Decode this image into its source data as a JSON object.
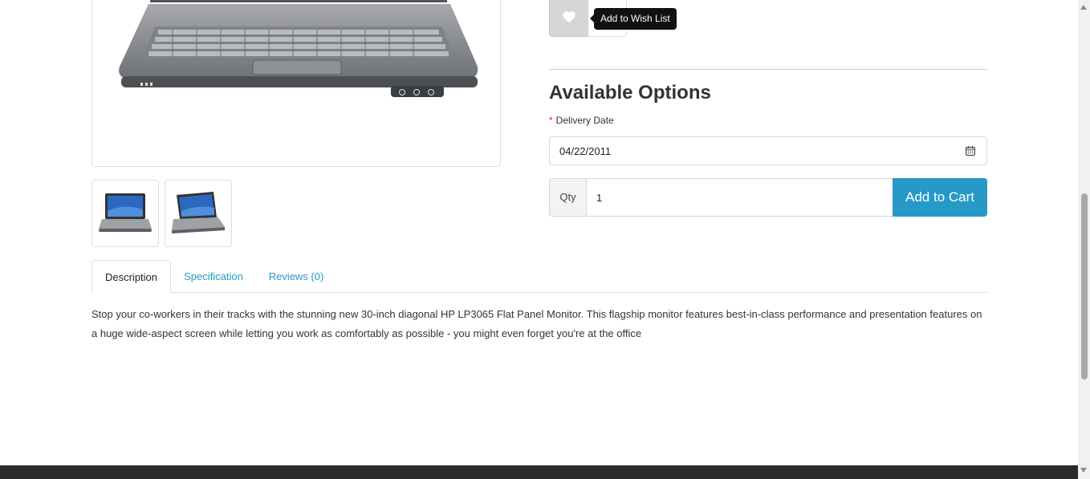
{
  "product": {
    "main_image_alt": "HP laptop product photo",
    "thumbnails": [
      "HP laptop thumbnail front",
      "HP laptop thumbnail angled"
    ]
  },
  "wishlist": {
    "tooltip": "Add to Wish List",
    "icon": "heart-icon"
  },
  "options": {
    "title": "Available Options",
    "delivery_label": "Delivery Date",
    "required_marker": "*",
    "delivery_value": "04/22/2011",
    "calendar_icon": "calendar-icon"
  },
  "purchase": {
    "qty_label": "Qty",
    "qty_value": "1",
    "cart_label": "Add to Cart"
  },
  "tabs": [
    {
      "label": "Description",
      "active": true
    },
    {
      "label": "Specification",
      "active": false
    },
    {
      "label": "Reviews (0)",
      "active": false
    }
  ],
  "description": "Stop your co-workers in their tracks with the stunning new 30-inch diagonal HP LP3065 Flat Panel Monitor. This flagship monitor features best-in-class performance and presentation features on a huge wide-aspect screen while letting you work as comfortably as possible - you might even forget you're at the office",
  "colors": {
    "accent": "#2799c7",
    "required": "#e0242c",
    "footer": "#2b2b2b"
  }
}
